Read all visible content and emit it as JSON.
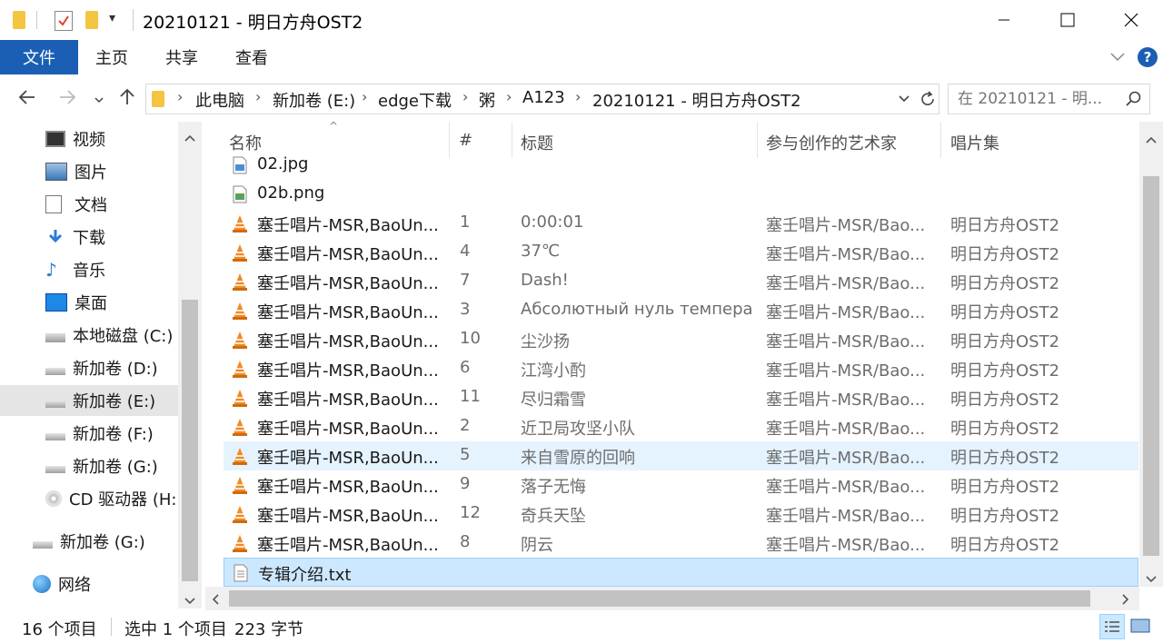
{
  "window": {
    "title": "20210121 - 明日方舟OST2"
  },
  "ribbon": {
    "tabs": [
      "文件",
      "主页",
      "共享",
      "查看"
    ]
  },
  "address": {
    "crumbs": [
      "此电脑",
      "新加卷 (E:)",
      "edge下载",
      "粥",
      "A123",
      "20210121 - 明日方舟OST2"
    ],
    "search_placeholder": "在 20210121 - 明..."
  },
  "sidebar": {
    "items": [
      {
        "label": "视频",
        "icon": "video-icon"
      },
      {
        "label": "图片",
        "icon": "pictures-icon"
      },
      {
        "label": "文档",
        "icon": "documents-icon"
      },
      {
        "label": "下载",
        "icon": "download-icon"
      },
      {
        "label": "音乐",
        "icon": "music-icon"
      },
      {
        "label": "桌面",
        "icon": "desktop-icon"
      },
      {
        "label": "本地磁盘 (C:)",
        "icon": "system-drive-icon"
      },
      {
        "label": "新加卷 (D:)",
        "icon": "drive-icon"
      },
      {
        "label": "新加卷 (E:)",
        "icon": "drive-icon",
        "selected": true
      },
      {
        "label": "新加卷 (F:)",
        "icon": "drive-icon"
      },
      {
        "label": "新加卷 (G:)",
        "icon": "drive-icon"
      },
      {
        "label": "CD 驱动器 (H:",
        "icon": "cd-drive-icon"
      },
      {
        "label": "新加卷 (G:)",
        "icon": "drive-icon"
      },
      {
        "label": "网络",
        "icon": "network-icon"
      }
    ]
  },
  "columns": {
    "name": "名称",
    "num": "#",
    "title": "标题",
    "artist": "参与创作的艺术家",
    "album": "唱片集"
  },
  "files": [
    {
      "name": "02.jpg",
      "type": "jpg",
      "num": "",
      "title": "",
      "artist": "",
      "album": ""
    },
    {
      "name": "02b.png",
      "type": "png",
      "num": "",
      "title": "",
      "artist": "",
      "album": ""
    },
    {
      "name": "塞壬唱片-MSR,BaoUn...",
      "type": "vlc",
      "num": "1",
      "title": "0:00:01",
      "artist": "塞壬唱片-MSR/Bao...",
      "album": "明日方舟OST2"
    },
    {
      "name": "塞壬唱片-MSR,BaoUn...",
      "type": "vlc",
      "num": "4",
      "title": "37℃",
      "artist": "塞壬唱片-MSR/Bao...",
      "album": "明日方舟OST2"
    },
    {
      "name": "塞壬唱片-MSR,BaoUn...",
      "type": "vlc",
      "num": "7",
      "title": "Dash!",
      "artist": "塞壬唱片-MSR/Bao...",
      "album": "明日方舟OST2"
    },
    {
      "name": "塞壬唱片-MSR,BaoUn...",
      "type": "vlc",
      "num": "3",
      "title": "Абсолютный нуль темпера...",
      "artist": "塞壬唱片-MSR/Bao...",
      "album": "明日方舟OST2"
    },
    {
      "name": "塞壬唱片-MSR,BaoUn...",
      "type": "vlc",
      "num": "10",
      "title": "尘沙扬",
      "artist": "塞壬唱片-MSR/Bao...",
      "album": "明日方舟OST2"
    },
    {
      "name": "塞壬唱片-MSR,BaoUn...",
      "type": "vlc",
      "num": "6",
      "title": "江湾小酌",
      "artist": "塞壬唱片-MSR/Bao...",
      "album": "明日方舟OST2"
    },
    {
      "name": "塞壬唱片-MSR,BaoUn...",
      "type": "vlc",
      "num": "11",
      "title": "尽归霜雪",
      "artist": "塞壬唱片-MSR/Bao...",
      "album": "明日方舟OST2"
    },
    {
      "name": "塞壬唱片-MSR,BaoUn...",
      "type": "vlc",
      "num": "2",
      "title": "近卫局攻坚小队",
      "artist": "塞壬唱片-MSR/Bao...",
      "album": "明日方舟OST2"
    },
    {
      "name": "塞壬唱片-MSR,BaoUn...",
      "type": "vlc",
      "num": "5",
      "title": "来自雪原的回响",
      "artist": "塞壬唱片-MSR/Bao...",
      "album": "明日方舟OST2",
      "state": "hover"
    },
    {
      "name": "塞壬唱片-MSR,BaoUn...",
      "type": "vlc",
      "num": "9",
      "title": "落子无悔",
      "artist": "塞壬唱片-MSR/Bao...",
      "album": "明日方舟OST2"
    },
    {
      "name": "塞壬唱片-MSR,BaoUn...",
      "type": "vlc",
      "num": "12",
      "title": "奇兵天坠",
      "artist": "塞壬唱片-MSR/Bao...",
      "album": "明日方舟OST2"
    },
    {
      "name": "塞壬唱片-MSR,BaoUn...",
      "type": "vlc",
      "num": "8",
      "title": "阴云",
      "artist": "塞壬唱片-MSR/Bao...",
      "album": "明日方舟OST2"
    },
    {
      "name": "专辑介绍.txt",
      "type": "txt",
      "num": "",
      "title": "",
      "artist": "",
      "album": "",
      "state": "selected"
    }
  ],
  "status": {
    "count": "16 个项目",
    "selection": "选中 1 个项目",
    "size": "223 字节"
  },
  "colors": {
    "accent": "#1a5fb4",
    "selected_bg": "#cce8ff",
    "hover_bg": "#e5f3ff",
    "vlc_orange": "#f08a24"
  }
}
